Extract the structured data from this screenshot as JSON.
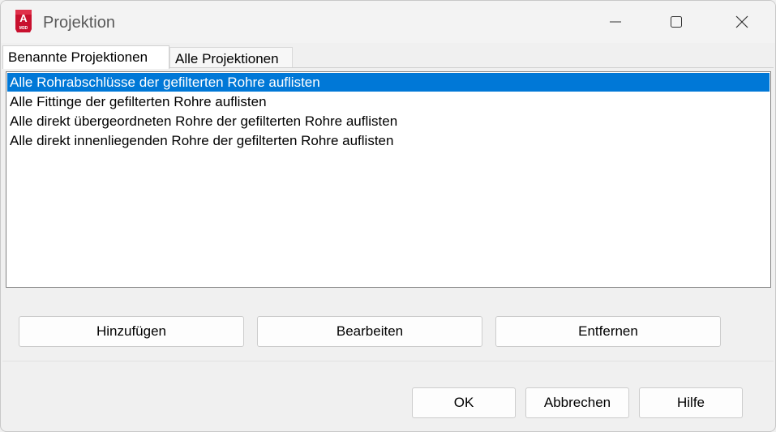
{
  "window": {
    "title": "Projektion",
    "app_icon": {
      "letter": "A",
      "sublabel": "M3D",
      "color": "#c8102e"
    }
  },
  "tabs": [
    {
      "label": "Benannte Projektionen",
      "active": true
    },
    {
      "label": "Alle Projektionen",
      "active": false
    }
  ],
  "projections": [
    {
      "label": "Alle Rohrabschlüsse der gefilterten Rohre auflisten",
      "selected": true
    },
    {
      "label": "Alle Fittinge der gefilterten Rohre auflisten",
      "selected": false
    },
    {
      "label": "Alle direkt übergeordneten Rohre der gefilterten Rohre auflisten",
      "selected": false
    },
    {
      "label": "Alle direkt innenliegenden Rohre der gefilterten Rohre auflisten",
      "selected": false
    }
  ],
  "list_buttons": {
    "add": "Hinzufügen",
    "edit": "Bearbeiten",
    "remove": "Entfernen"
  },
  "dialog_buttons": {
    "ok": "OK",
    "cancel": "Abbrechen",
    "help": "Hilfe"
  },
  "colors": {
    "selection": "#0078d7",
    "selection_text": "#ffffff"
  }
}
